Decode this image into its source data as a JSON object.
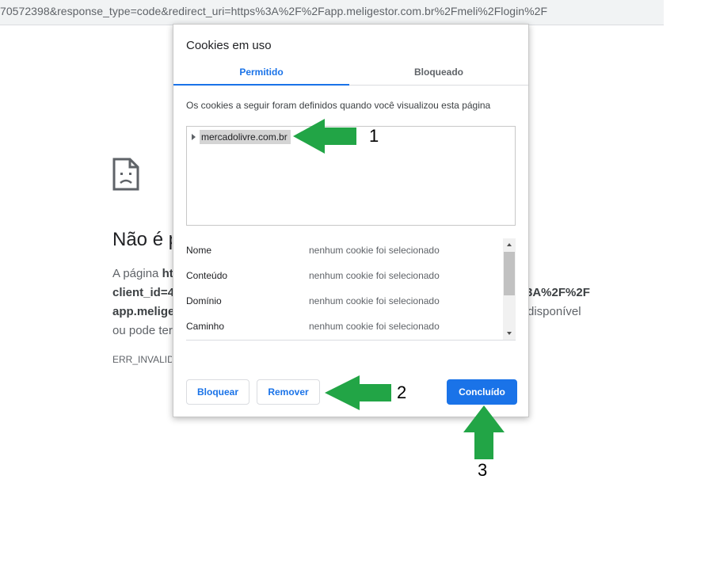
{
  "browser": {
    "url": "70572398&response_type=code&redirect_uri=https%3A%2F%2Fapp.meligestor.com.br%2Fmeli%2Flogin%2F"
  },
  "error_page": {
    "title": "Não é p",
    "line1_prefix": "A página ",
    "line1_bold": "ht",
    "line2_bold": "client_id",
    "line2_rest": "=4",
    "line2_right": "3A%2F%2F",
    "line3_bold": "app.melige",
    "line3_right": "disponível",
    "line4": "ou pode ter",
    "error_code": "ERR_INVALID_"
  },
  "dialog": {
    "title": "Cookies em uso",
    "tabs": [
      {
        "label": "Permitido",
        "active": true
      },
      {
        "label": "Bloqueado",
        "active": false
      }
    ],
    "description": "Os cookies a seguir foram definidos quando você visualizou esta página",
    "tree_items": [
      {
        "label": "mercadolivre.com.br"
      }
    ],
    "details": [
      {
        "label": "Nome",
        "value": "nenhum cookie foi selecionado"
      },
      {
        "label": "Conteúdo",
        "value": "nenhum cookie foi selecionado"
      },
      {
        "label": "Domínio",
        "value": "nenhum cookie foi selecionado"
      },
      {
        "label": "Caminho",
        "value": "nenhum cookie foi selecionado"
      }
    ],
    "buttons": {
      "block": "Bloquear",
      "remove": "Remover",
      "done": "Concluído"
    }
  },
  "annotations": {
    "arrow_color": "#22a546",
    "labels": [
      "1",
      "2",
      "3"
    ]
  },
  "colors": {
    "accent": "#1a73e8"
  }
}
